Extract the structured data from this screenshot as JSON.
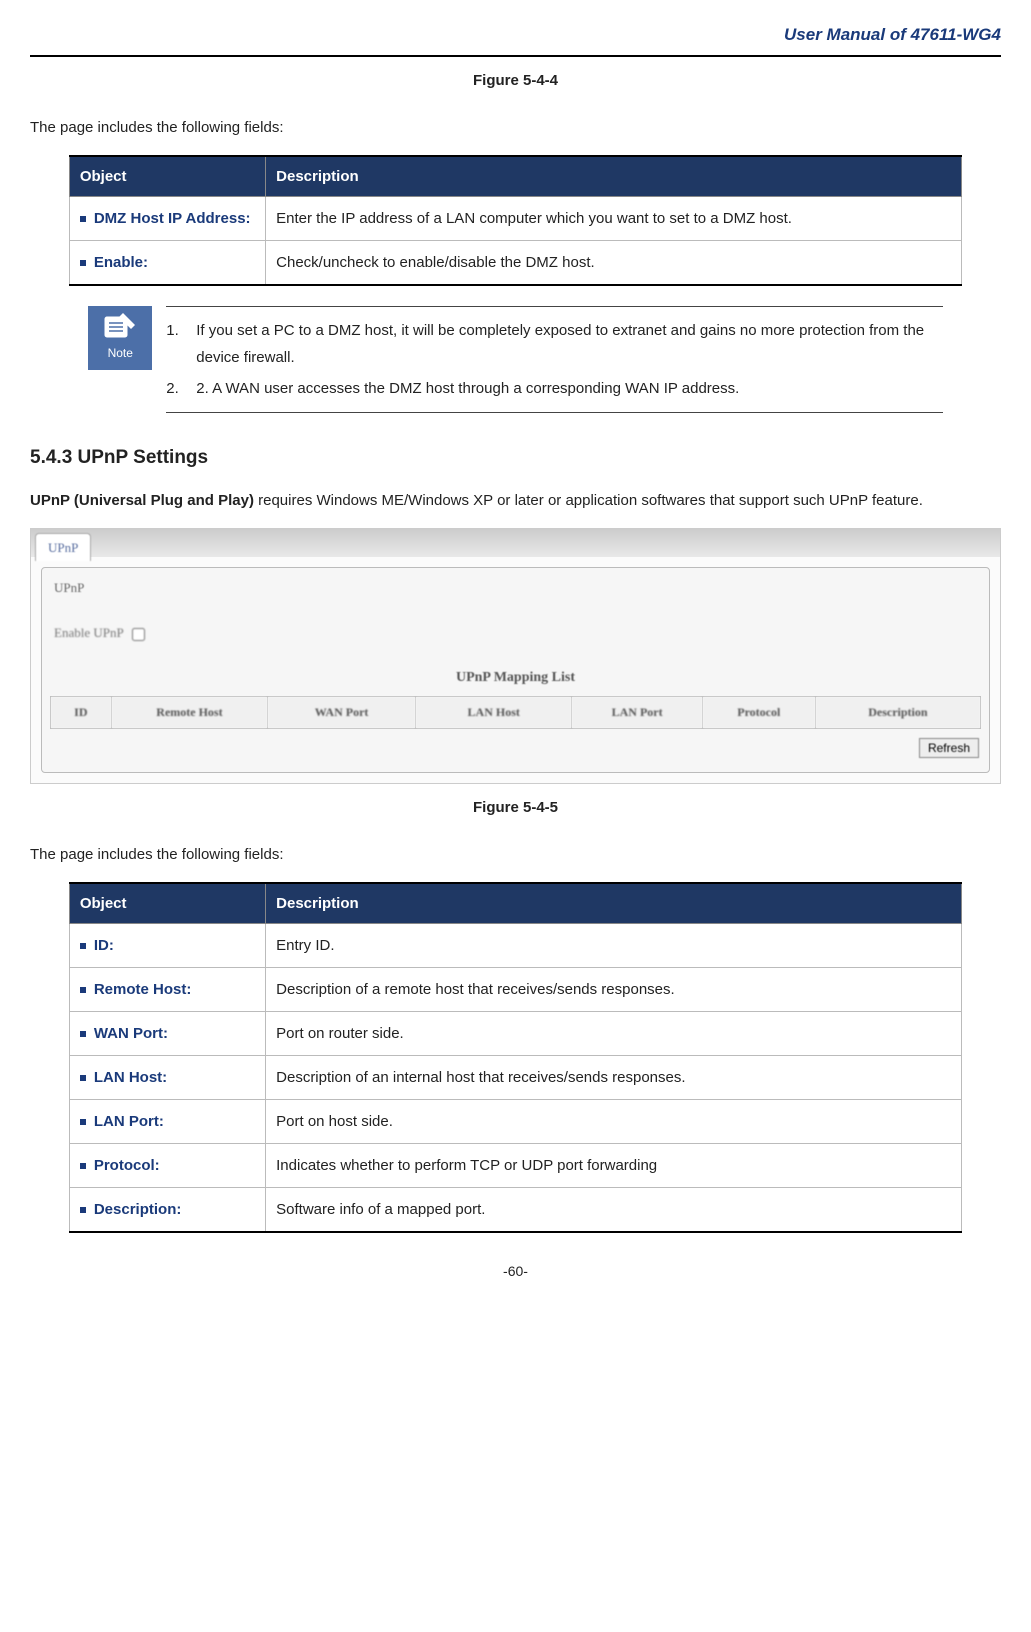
{
  "header": {
    "title": "User Manual of 47611-WG4"
  },
  "figure1": {
    "caption": "Figure 5-4-4"
  },
  "intro1": "The page includes the following fields:",
  "table1": {
    "head_object": "Object",
    "head_description": "Description",
    "rows": [
      {
        "obj": "DMZ Host IP Address:",
        "desc": "Enter the IP address of a LAN computer which you want to set to a DMZ host."
      },
      {
        "obj": "Enable:",
        "desc": "Check/uncheck to enable/disable the DMZ host."
      }
    ]
  },
  "note": {
    "label": "Note",
    "items": [
      {
        "num": "1.",
        "text": "If you set a PC to a DMZ host, it will be completely exposed to extranet and gains no more protection from the device firewall."
      },
      {
        "num": "2.",
        "text": "2. A WAN user accesses the DMZ host through a corresponding WAN IP address."
      }
    ]
  },
  "section": {
    "heading": "5.4.3   UPnP Settings",
    "bold": "UPnP (Universal Plug and Play)",
    "rest": " requires Windows ME/Windows XP or later or application softwares that support such UPnP feature."
  },
  "screenshot": {
    "tab": "UPnP",
    "panel_title": "UPnP",
    "enable_label": "Enable UPnP",
    "mapping_title": "UPnP Mapping List",
    "cols": [
      "ID",
      "Remote Host",
      "WAN Port",
      "LAN Host",
      "LAN Port",
      "Protocol",
      "Description"
    ],
    "refresh": "Refresh"
  },
  "figure2": {
    "caption": "Figure 5-4-5"
  },
  "intro2": "The page includes the following fields:",
  "table2": {
    "head_object": "Object",
    "head_description": "Description",
    "rows": [
      {
        "obj": "ID:",
        "desc": "Entry ID."
      },
      {
        "obj": "Remote Host:",
        "desc": "Description of a remote host that receives/sends responses."
      },
      {
        "obj": "WAN Port:",
        "desc": "Port on router side."
      },
      {
        "obj": "LAN Host:",
        "desc": "Description of an internal host that receives/sends responses."
      },
      {
        "obj": "LAN Port:",
        "desc": "Port on host side."
      },
      {
        "obj": "Protocol:",
        "desc": "Indicates whether to perform TCP or UDP port forwarding"
      },
      {
        "obj": "Description:",
        "desc": "Software info of a mapped port."
      }
    ]
  },
  "page_number": "-60-"
}
